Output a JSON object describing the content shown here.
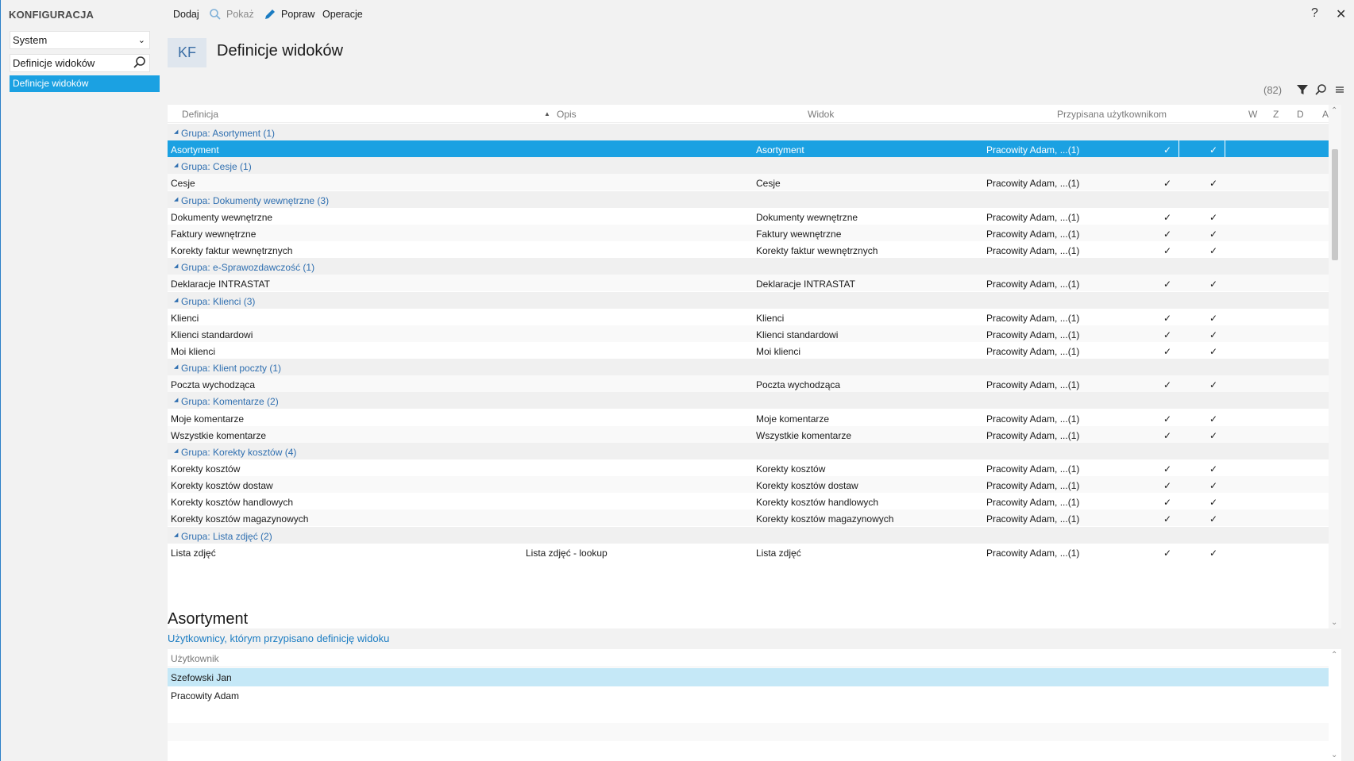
{
  "sidebar": {
    "title": "KONFIGURACJA",
    "module_select": "System",
    "search_value": "Definicje widoków",
    "selected_item": "Definicje widoków"
  },
  "toolbar": {
    "add_label": "Dodaj",
    "show_label": "Pokaż",
    "edit_label": "Popraw",
    "operations_label": "Operacje",
    "help_glyph": "?",
    "close_glyph": "✕"
  },
  "header": {
    "badge": "KF",
    "title": "Definicje widoków"
  },
  "grid": {
    "count": "(82)",
    "columns": [
      "Definicja",
      "Opis",
      "Widok",
      "Przypisana użytkownikom",
      "W",
      "Z",
      "D",
      "A"
    ],
    "rows": [
      {
        "type": "group",
        "label": "Grupa: Asortyment (1)"
      },
      {
        "type": "data",
        "selected": true,
        "definicja": "Asortyment",
        "opis": "",
        "widok": "Asortyment",
        "przypisana": "Pracowity Adam, ...(1)",
        "w": "✓",
        "z": "",
        "d": "✓",
        "a": ""
      },
      {
        "type": "group",
        "label": "Grupa: Cesje (1)"
      },
      {
        "type": "data",
        "definicja": "Cesje",
        "opis": "",
        "widok": "Cesje",
        "przypisana": "Pracowity Adam, ...(1)",
        "w": "✓",
        "z": "",
        "d": "✓",
        "a": ""
      },
      {
        "type": "group",
        "label": "Grupa: Dokumenty wewnętrzne (3)"
      },
      {
        "type": "data",
        "definicja": "Dokumenty wewnętrzne",
        "opis": "",
        "widok": "Dokumenty wewnętrzne",
        "przypisana": "Pracowity Adam, ...(1)",
        "w": "✓",
        "z": "",
        "d": "✓",
        "a": ""
      },
      {
        "type": "data",
        "definicja": "Faktury wewnętrzne",
        "opis": "",
        "widok": "Faktury wewnętrzne",
        "przypisana": "Pracowity Adam, ...(1)",
        "w": "✓",
        "z": "",
        "d": "✓",
        "a": ""
      },
      {
        "type": "data",
        "definicja": "Korekty faktur wewnętrznych",
        "opis": "",
        "widok": "Korekty faktur wewnętrznych",
        "przypisana": "Pracowity Adam, ...(1)",
        "w": "✓",
        "z": "",
        "d": "✓",
        "a": ""
      },
      {
        "type": "group",
        "label": "Grupa: e-Sprawozdawczość (1)"
      },
      {
        "type": "data",
        "definicja": "Deklaracje INTRASTAT",
        "opis": "",
        "widok": "Deklaracje INTRASTAT",
        "przypisana": "Pracowity Adam, ...(1)",
        "w": "✓",
        "z": "",
        "d": "✓",
        "a": ""
      },
      {
        "type": "group",
        "label": "Grupa: Klienci (3)"
      },
      {
        "type": "data",
        "definicja": "Klienci",
        "opis": "",
        "widok": "Klienci",
        "przypisana": "Pracowity Adam, ...(1)",
        "w": "✓",
        "z": "",
        "d": "✓",
        "a": ""
      },
      {
        "type": "data",
        "definicja": "Klienci standardowi",
        "opis": "",
        "widok": "Klienci standardowi",
        "przypisana": "Pracowity Adam, ...(1)",
        "w": "✓",
        "z": "",
        "d": "✓",
        "a": ""
      },
      {
        "type": "data",
        "definicja": "Moi klienci",
        "opis": "",
        "widok": "Moi klienci",
        "przypisana": "Pracowity Adam, ...(1)",
        "w": "✓",
        "z": "",
        "d": "✓",
        "a": ""
      },
      {
        "type": "group",
        "label": "Grupa: Klient poczty (1)"
      },
      {
        "type": "data",
        "definicja": "Poczta wychodząca",
        "opis": "",
        "widok": "Poczta wychodząca",
        "przypisana": "Pracowity Adam, ...(1)",
        "w": "✓",
        "z": "",
        "d": "✓",
        "a": ""
      },
      {
        "type": "group",
        "label": "Grupa: Komentarze (2)"
      },
      {
        "type": "data",
        "definicja": "Moje komentarze",
        "opis": "",
        "widok": "Moje komentarze",
        "przypisana": "Pracowity Adam, ...(1)",
        "w": "✓",
        "z": "",
        "d": "✓",
        "a": ""
      },
      {
        "type": "data",
        "definicja": "Wszystkie komentarze",
        "opis": "",
        "widok": "Wszystkie komentarze",
        "przypisana": "Pracowity Adam, ...(1)",
        "w": "✓",
        "z": "",
        "d": "✓",
        "a": ""
      },
      {
        "type": "group",
        "label": "Grupa: Korekty kosztów (4)"
      },
      {
        "type": "data",
        "definicja": "Korekty kosztów",
        "opis": "",
        "widok": "Korekty kosztów",
        "przypisana": "Pracowity Adam, ...(1)",
        "w": "✓",
        "z": "",
        "d": "✓",
        "a": ""
      },
      {
        "type": "data",
        "definicja": "Korekty kosztów dostaw",
        "opis": "",
        "widok": "Korekty kosztów dostaw",
        "przypisana": "Pracowity Adam, ...(1)",
        "w": "✓",
        "z": "",
        "d": "✓",
        "a": ""
      },
      {
        "type": "data",
        "definicja": "Korekty kosztów handlowych",
        "opis": "",
        "widok": "Korekty kosztów handlowych",
        "przypisana": "Pracowity Adam, ...(1)",
        "w": "✓",
        "z": "",
        "d": "✓",
        "a": ""
      },
      {
        "type": "data",
        "definicja": "Korekty kosztów magazynowych",
        "opis": "",
        "widok": "Korekty kosztów magazynowych",
        "przypisana": "Pracowity Adam, ...(1)",
        "w": "✓",
        "z": "",
        "d": "✓",
        "a": ""
      },
      {
        "type": "group",
        "label": "Grupa: Lista zdjęć (2)"
      },
      {
        "type": "data",
        "definicja": "Lista zdjęć",
        "opis": "Lista zdjęć - lookup",
        "widok": "Lista zdjęć",
        "przypisana": "Pracowity Adam, ...(1)",
        "w": "✓",
        "z": "",
        "d": "✓",
        "a": ""
      }
    ]
  },
  "detail": {
    "title": "Asortyment",
    "subtitle": "Użytkownicy, którym przypisano definicję widoku",
    "column": "Użytkownik",
    "users": [
      "Szefowski Jan",
      "Pracowity Adam"
    ]
  },
  "colors": {
    "accent": "#1ba1e2",
    "group_text": "#2f6fb0",
    "selected_light": "#c5e8f7"
  }
}
